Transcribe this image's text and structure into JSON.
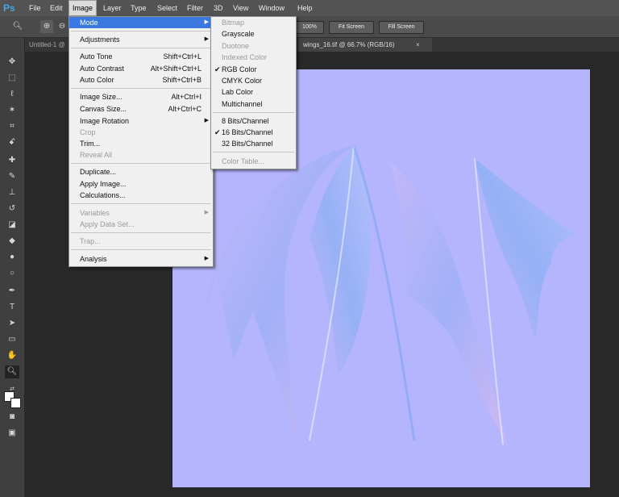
{
  "app": {
    "logo": "Ps"
  },
  "menubar": [
    "File",
    "Edit",
    "Image",
    "Layer",
    "Type",
    "Select",
    "Filter",
    "3D",
    "View",
    "Window",
    "Help"
  ],
  "options": {
    "btn_100": "100%",
    "fit": "Fit Screen",
    "fill": "Fill Screen"
  },
  "tabs": [
    {
      "label": "Untitled-1 @"
    },
    {
      "label": "wings_16.tif @ 66.7% (RGB/16)"
    }
  ],
  "image_menu": [
    {
      "label": "Mode",
      "highlight": true,
      "submenu": true
    },
    {
      "label": "Adjustments",
      "submenu": true
    },
    {
      "label": "Auto Tone",
      "shortcut": "Shift+Ctrl+L"
    },
    {
      "label": "Auto Contrast",
      "shortcut": "Alt+Shift+Ctrl+L"
    },
    {
      "label": "Auto Color",
      "shortcut": "Shift+Ctrl+B"
    },
    {
      "label": "Image Size...",
      "shortcut": "Alt+Ctrl+I"
    },
    {
      "label": "Canvas Size...",
      "shortcut": "Alt+Ctrl+C"
    },
    {
      "label": "Image Rotation",
      "submenu": true
    },
    {
      "label": "Crop",
      "disabled": true
    },
    {
      "label": "Trim..."
    },
    {
      "label": "Reveal All",
      "disabled": true
    },
    {
      "label": "Duplicate..."
    },
    {
      "label": "Apply Image..."
    },
    {
      "label": "Calculations..."
    },
    {
      "label": "Variables",
      "disabled": true,
      "submenu": true
    },
    {
      "label": "Apply Data Set...",
      "disabled": true
    },
    {
      "label": "Trap...",
      "disabled": true
    },
    {
      "label": "Analysis",
      "submenu": true
    }
  ],
  "mode_menu": [
    {
      "label": "Bitmap",
      "disabled": true
    },
    {
      "label": "Grayscale"
    },
    {
      "label": "Duotone",
      "disabled": true
    },
    {
      "label": "Indexed Color",
      "disabled": true
    },
    {
      "label": "RGB Color",
      "checked": true
    },
    {
      "label": "CMYK Color"
    },
    {
      "label": "Lab Color"
    },
    {
      "label": "Multichannel"
    },
    {
      "label": "8 Bits/Channel"
    },
    {
      "label": "16 Bits/Channel",
      "checked": true
    },
    {
      "label": "32 Bits/Channel"
    },
    {
      "label": "Color Table...",
      "disabled": true
    }
  ],
  "glyphs": {
    "check": "✔",
    "arrow": "▶"
  },
  "colors": {
    "menu_highlight": "#3b78e0",
    "canvas": "#b5b5fd",
    "menubar": "#535353"
  }
}
